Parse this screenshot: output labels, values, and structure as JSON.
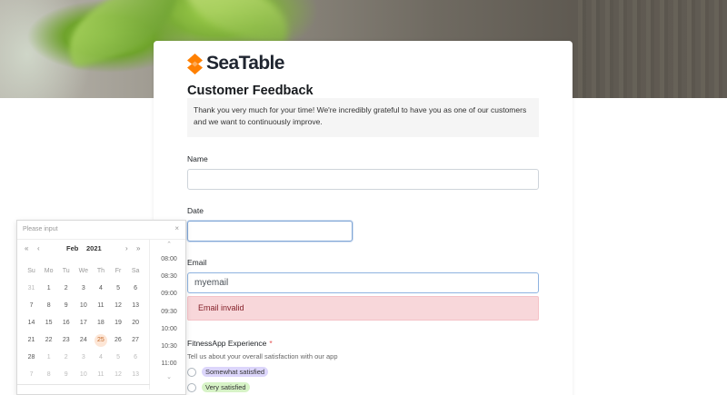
{
  "brand": {
    "name": "SeaTable",
    "accent": "#ff8000"
  },
  "form": {
    "title": "Customer Feedback",
    "description": "Thank you very much for your time! We're incredibly grateful to have you as one of our customers and we want to continuously improve.",
    "name_label": "Name",
    "name_value": "",
    "date_label": "Date",
    "date_value": "",
    "email_label": "Email",
    "email_value": "myemail",
    "email_error": "Email invalid",
    "fitness_label": "FitnessApp Experience",
    "required_mark": "*",
    "fitness_hint": "Tell us about your overall satisfaction with our app",
    "options": [
      "Somewhat satisfied",
      "Very satisfied"
    ]
  },
  "picker": {
    "placeholder": "Please input",
    "close": "×",
    "prev_year": "«",
    "prev_month": "‹",
    "month": "Feb",
    "year": "2021",
    "next_month": "›",
    "next_year": "»",
    "weekdays": [
      "Su",
      "Mo",
      "Tu",
      "We",
      "Th",
      "Fr",
      "Sa"
    ],
    "weeks": [
      [
        "31",
        "1",
        "2",
        "3",
        "4",
        "5",
        "6"
      ],
      [
        "7",
        "8",
        "9",
        "10",
        "11",
        "12",
        "13"
      ],
      [
        "14",
        "15",
        "16",
        "17",
        "18",
        "19",
        "20"
      ],
      [
        "21",
        "22",
        "23",
        "24",
        "25",
        "26",
        "27"
      ],
      [
        "28",
        "1",
        "2",
        "3",
        "4",
        "5",
        "6"
      ],
      [
        "7",
        "8",
        "9",
        "10",
        "11",
        "12",
        "13"
      ]
    ],
    "today": "25",
    "times_up": "⌃",
    "times_down": "⌄",
    "times": [
      "08:00",
      "08:30",
      "09:00",
      "09:30",
      "10:00",
      "10:30",
      "11:00"
    ]
  }
}
